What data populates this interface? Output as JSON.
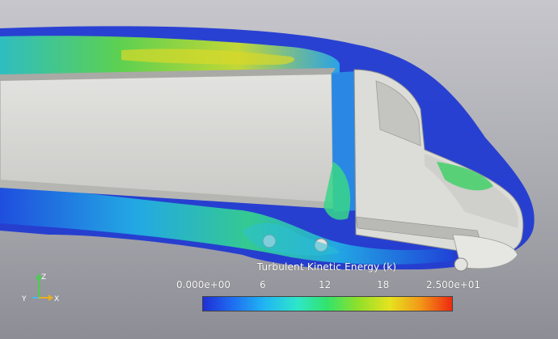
{
  "colorbar": {
    "title": "Turbulent Kinetic Energy (k)",
    "ticks": [
      "0.000e+00",
      "6",
      "12",
      "18",
      "2.500e+01"
    ],
    "min": 0,
    "max": 25
  },
  "axes": {
    "z_label": "Z",
    "y_label": "Y",
    "x_label": "X"
  },
  "colors": {
    "background_top": "#c6c6cc",
    "background_bottom": "#8d8d95",
    "truck_surface": "#d8d8d4",
    "low_value": "#1f2fd6",
    "high_value": "#ee2a10"
  }
}
